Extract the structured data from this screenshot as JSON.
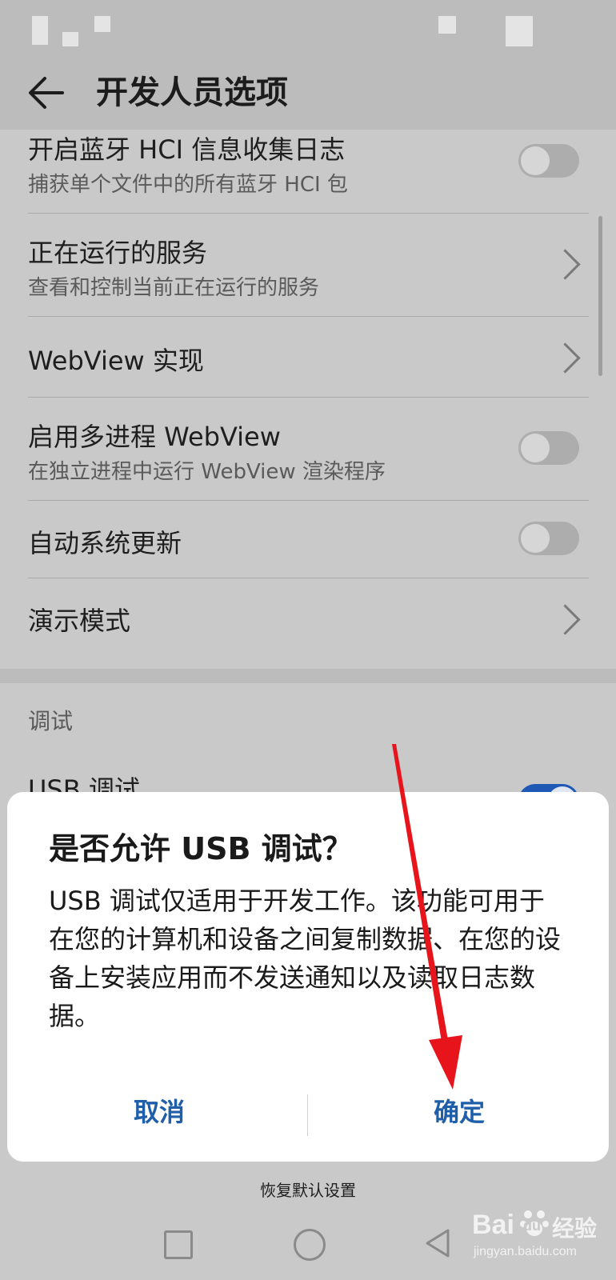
{
  "header": {
    "title": "开发人员选项"
  },
  "settings": {
    "items": [
      {
        "title": "开启蓝牙 HCI 信息收集日志",
        "subtitle": "捕获单个文件中的所有蓝牙 HCI 包",
        "control": "toggle",
        "on": false
      },
      {
        "title": "正在运行的服务",
        "subtitle": "查看和控制当前正在运行的服务",
        "control": "chevron"
      },
      {
        "title": "WebView 实现",
        "control": "chevron"
      },
      {
        "title": "启用多进程 WebView",
        "subtitle": "在独立进程中运行 WebView 渲染程序",
        "control": "toggle",
        "on": false
      },
      {
        "title": "自动系统更新",
        "control": "toggle",
        "on": false
      },
      {
        "title": "演示模式",
        "control": "chevron"
      }
    ],
    "section_debug": "调试",
    "usb_debug_title": "USB 调试",
    "usb_debug_on": true
  },
  "dialog": {
    "title": "是否允许 USB 调试？",
    "body": "USB 调试仅适用于开发工作。该功能可用于在您的计算机和设备之间复制数据、在您的设备上安装应用而不发送通知以及读取日志数据。",
    "cancel_label": "取消",
    "ok_label": "确定"
  },
  "bottom": {
    "reset_label": "恢复默认设置"
  },
  "watermark": {
    "brand": "Bai",
    "brand2": "du",
    "cn": "经验",
    "url": "jingyan.baidu.com"
  },
  "colors": {
    "accent": "#1f5ea8",
    "annotation_arrow": "#e8141c"
  }
}
